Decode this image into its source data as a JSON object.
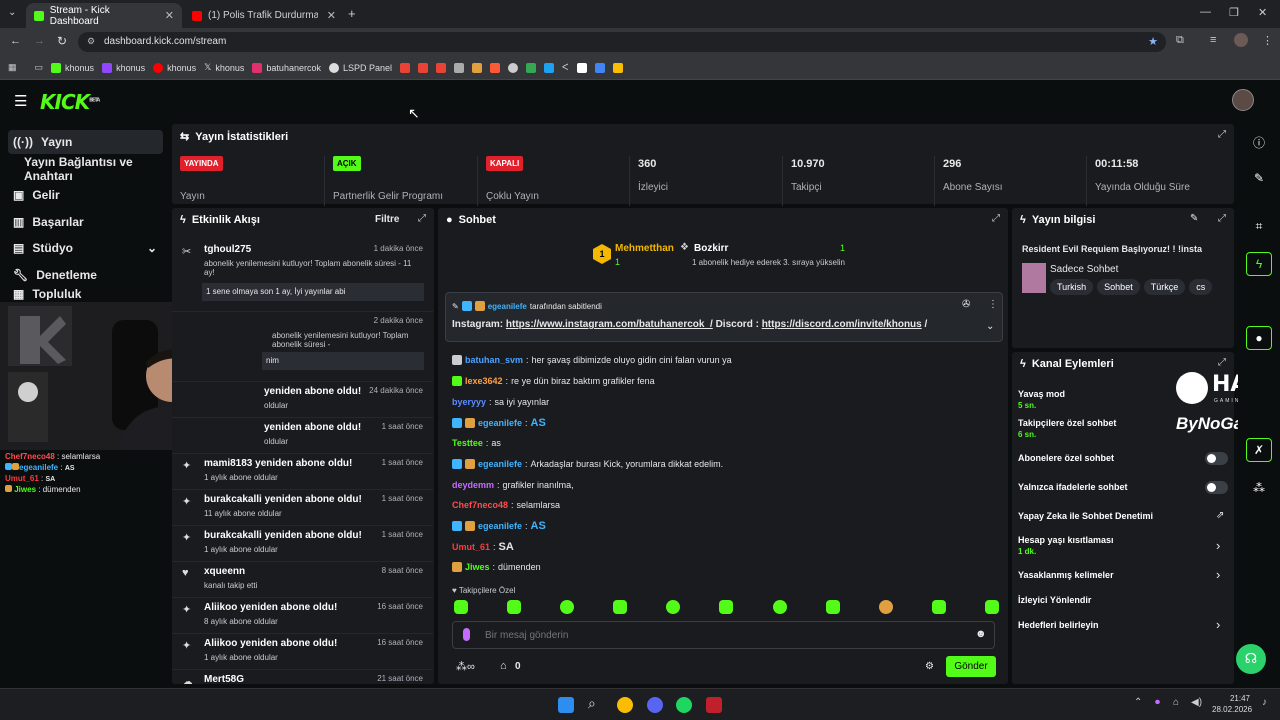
{
  "browser": {
    "tabs": [
      {
        "title": "Stream - Kick Dashboard"
      },
      {
        "title": "(1) Polis Trafik Durdurmasında /"
      }
    ],
    "url": "dashboard.kick.com/stream",
    "bookmarks": [
      "khonus",
      "khonus",
      "khonus",
      "khonus",
      "batuhanercok",
      "LSPD Panel"
    ]
  },
  "header": {
    "logo": "KICK",
    "beta": "BETA"
  },
  "sidebar": {
    "items": [
      {
        "label": "Yayın",
        "icon": "broadcast-icon"
      },
      {
        "label": "Yayın Bağlantısı ve Anahtarı"
      },
      {
        "label": "Gelir",
        "icon": "money-icon"
      },
      {
        "label": "Başarılar",
        "icon": "trophy-icon"
      },
      {
        "label": "Stüdyo",
        "icon": "studio-icon"
      },
      {
        "label": "Denetleme",
        "icon": "wrench-icon"
      },
      {
        "label": "Topluluk",
        "icon": "community-icon"
      }
    ]
  },
  "stats": {
    "title": "Yayın İstatistikleri",
    "items": [
      {
        "badge": "YAYINDA",
        "badge_color": "#e0202b",
        "label": "Yayın"
      },
      {
        "badge": "AÇIK",
        "badge_color": "#53fc18",
        "label": "Partnerlik Gelir Programı"
      },
      {
        "badge": "KAPALI",
        "badge_color": "#e0202b",
        "label": "Çoklu Yayın"
      },
      {
        "value": "360",
        "label": "İzleyici"
      },
      {
        "value": "10.970",
        "label": "Takipçi"
      },
      {
        "value": "296",
        "label": "Abone Sayısı"
      },
      {
        "value": "00:11:58",
        "label": "Yayında Olduğu Süre"
      }
    ]
  },
  "events": {
    "title": "Etkinlik Akışı",
    "filter": "Filtre",
    "items": [
      {
        "name": "tghoul275",
        "time": "1 dakika önce",
        "desc": "abonelik yenilemesini kutluyor! Toplam abonelik süresi - 11 ay!",
        "msg": "1 sene olmaya son 1 ay, İyi yayınlar abi"
      },
      {
        "name": "",
        "time": "2 dakika önce",
        "desc": "abonelik yenilemesini kutluyor! Toplam abonelik süresi -",
        "msg": "nim"
      },
      {
        "name": "yeniden abone oldu!",
        "time": "24 dakika önce",
        "desc": "oldular"
      },
      {
        "name": "yeniden abone oldu!",
        "time": "1 saat önce",
        "desc": "oldular"
      },
      {
        "name": "mami8183 yeniden abone oldu!",
        "time": "1 saat önce",
        "desc": "1 aylık abone oldular"
      },
      {
        "name": "burakcakalli yeniden abone oldu!",
        "time": "1 saat önce",
        "desc": "11 aylık abone oldular"
      },
      {
        "name": "burakcakalli yeniden abone oldu!",
        "time": "1 saat önce",
        "desc": "1 aylık abone oldular"
      },
      {
        "name": "xqueenn",
        "time": "8 saat önce",
        "desc": "kanalı takip etti"
      },
      {
        "name": "Aliikoo yeniden abone oldu!",
        "time": "16 saat önce",
        "desc": "8 aylık abone oldular"
      },
      {
        "name": "Aliikoo yeniden abone oldu!",
        "time": "16 saat önce",
        "desc": "1 aylık abone oldular"
      },
      {
        "name": "Mert58G",
        "time": "21 saat önce",
        "desc": ""
      }
    ]
  },
  "chat": {
    "title": "Sohbet",
    "top": [
      {
        "name": "Mehmetthan",
        "count": "1"
      },
      {
        "name": "Bozkirr",
        "count": "1",
        "note": "1 abonelik hediye ederek 3. sıraya yükselin"
      }
    ],
    "pinned": {
      "by": "egeanilefe",
      "by_suffix": "tarafından sabitlendi",
      "text_prefix": "Instagram:",
      "link1": "https://www.instagram.com/batuhanercok_/",
      "mid": "Discord :",
      "link2": "https://discord.com/invite/khonus",
      "tail": "/"
    },
    "messages": [
      {
        "user": "batuhan_svm",
        "color": "#4aa3ff",
        "text": "her şavaş dibimizde oluyo gidin cini falan vurun ya"
      },
      {
        "user": "lexe3642",
        "color": "#ff9f43",
        "text": "re ye dün biraz baktım grafikler fena"
      },
      {
        "user": "byeryyy",
        "color": "#5b8cff",
        "text": "sa iyi yayınlar"
      },
      {
        "user": "egeanilefe",
        "color": "#3fb4ff",
        "text": "AS"
      },
      {
        "user": "Testtee",
        "color": "#53fc18",
        "text": "as"
      },
      {
        "user": "egeanilefe",
        "color": "#3fb4ff",
        "text": "Arkadaşlar burası Kick, yorumlara dikkat edelim."
      },
      {
        "user": "deydemm",
        "color": "#c56bff",
        "text": "grafikler inanılma,"
      },
      {
        "user": "Chef7neco48",
        "color": "#ff4d4d",
        "text": "selamlarsa"
      },
      {
        "user": "egeanilefe",
        "color": "#3fb4ff",
        "text": "AS"
      },
      {
        "user": "Umut_61",
        "color": "#ff3b3b",
        "text": "SA"
      },
      {
        "user": "Jiwes",
        "color": "#53fc18",
        "text": "dümenden"
      }
    ],
    "emote_label": "Takipçilere Özel",
    "input_placeholder": "Bir mesaj gönderin",
    "points": "0",
    "send": "Gönder"
  },
  "overlay_chat": [
    {
      "user": "Chef7neco48",
      "color": "#ff4d4d",
      "text": "selamlarsa"
    },
    {
      "user": "egeanilefe",
      "color": "#3fb4ff",
      "text": "AS"
    },
    {
      "user": "Umut_61",
      "color": "#ff3b3b",
      "text": "SA"
    },
    {
      "user": "Jiwes",
      "color": "#53fc18",
      "text": "dümenden"
    }
  ],
  "stream_info": {
    "title": "Yayın bilgisi",
    "stream_title": "Resident Evil Requiem Başlıyoruz! ! !insta",
    "category": "Sadece Sohbet",
    "tags": [
      "Turkish",
      "Sohbet",
      "Türkçe",
      "cs"
    ]
  },
  "channel_actions": {
    "title": "Kanal Eylemleri",
    "items": [
      {
        "label": "Yavaş mod",
        "sub": "5 sn."
      },
      {
        "label": "Takipçilere özel sohbet",
        "sub": "6 sn."
      },
      {
        "label": "Abonelere özel sohbet"
      },
      {
        "label": "Yalnızca ifadelerle sohbet"
      },
      {
        "label": "Yapay Zeka ile Sohbet Denetimi"
      },
      {
        "label": "Hesap yaşı kısıtlaması",
        "sub": "1 dk."
      },
      {
        "label": "Yasaklanmış kelimeler"
      },
      {
        "label": "İzleyici Yönlendir"
      },
      {
        "label": "Hedefleri belirleyin"
      }
    ]
  },
  "overlay_logos": {
    "hawk": "HAWK",
    "hawk_sub": "GAMING CHAIR",
    "bynogame": "ByNoGame"
  },
  "taskbar": {
    "time": "21:47",
    "date": "28.02.2026"
  },
  "colors": {
    "accent": "#53fc18",
    "bg": "#0b0e0f",
    "panel": "#191b1f"
  }
}
